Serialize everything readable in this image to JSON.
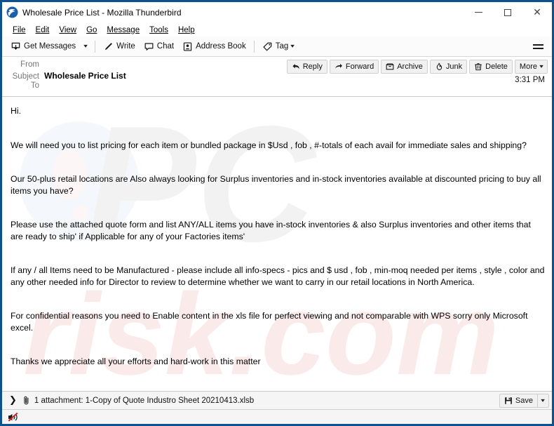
{
  "window": {
    "title": "Wholesale Price List - Mozilla Thunderbird",
    "app_icon": "thunderbird-icon",
    "frame_color": "#0d5191",
    "controls": {
      "minimize": "minimize-icon",
      "maximize": "maximize-icon",
      "close": "close-icon"
    }
  },
  "menubar": {
    "items": [
      {
        "label": "File",
        "accel": "F"
      },
      {
        "label": "Edit",
        "accel": "E"
      },
      {
        "label": "View",
        "accel": "V"
      },
      {
        "label": "Go",
        "accel": "G"
      },
      {
        "label": "Message",
        "accel": "M"
      },
      {
        "label": "Tools",
        "accel": "T"
      },
      {
        "label": "Help",
        "accel": "H"
      }
    ]
  },
  "toolbar": {
    "get_messages": "Get Messages",
    "write": "Write",
    "chat": "Chat",
    "address_book": "Address Book",
    "tag": "Tag",
    "app_menu": "app-menu-icon"
  },
  "message_header": {
    "from_label": "From",
    "from_value": "",
    "subject_label": "Subject",
    "subject_value": "Wholesale Price List",
    "to_label": "To",
    "to_value": "",
    "time": "3:31 PM",
    "actions": [
      {
        "label": "Reply",
        "icon": "reply-icon"
      },
      {
        "label": "Forward",
        "icon": "forward-icon"
      },
      {
        "label": "Archive",
        "icon": "archive-icon"
      },
      {
        "label": "Junk",
        "icon": "junk-icon"
      },
      {
        "label": "Delete",
        "icon": "delete-icon"
      },
      {
        "label": "More",
        "icon": "chevron-down-icon"
      }
    ]
  },
  "body": {
    "watermark": "pcrisk.com",
    "paragraphs": [
      "Hi.",
      "We will need you to list pricing for each item or bundled package in $Usd , fob , #-totals of each avail for immediate sales and shipping?",
      "Our 50-plus retail locations are Also always looking for Surplus inventories and in-stock inventories available at discounted pricing to buy all items you have?",
      "Please use the attached quote form and list ANY/ALL items you have in-stock inventories & also Surplus inventories and  other items that are ready to ship' if Applicable for any of your Factories items'",
      "If any / all Items need to be Manufactured - please include all info-specs - pics and $ usd  , fob , min-moq needed per items , style , color and any other needed info for Director to review to determine whether we want to carry in our retail locations in North America.",
      "For confidential reasons you need to Enable content in the xls file for perfect viewing and not comparable with WPS sorry only Microsoft excel.",
      "Thanks  we appreciate all your efforts and hard-work in this matter"
    ]
  },
  "attachment_bar": {
    "expand_icon": "chevron-right-icon",
    "paperclip_icon": "paperclip-icon",
    "text": "1 attachment: 1-Copy of Quote Industro Sheet 20210413.xlsb",
    "save_label": "Save",
    "save_icon": "save-disk-icon",
    "save_dropdown_icon": "chevron-down-icon"
  },
  "statusbar": {
    "indicator_icon": "blocked-remote-content-icon"
  }
}
